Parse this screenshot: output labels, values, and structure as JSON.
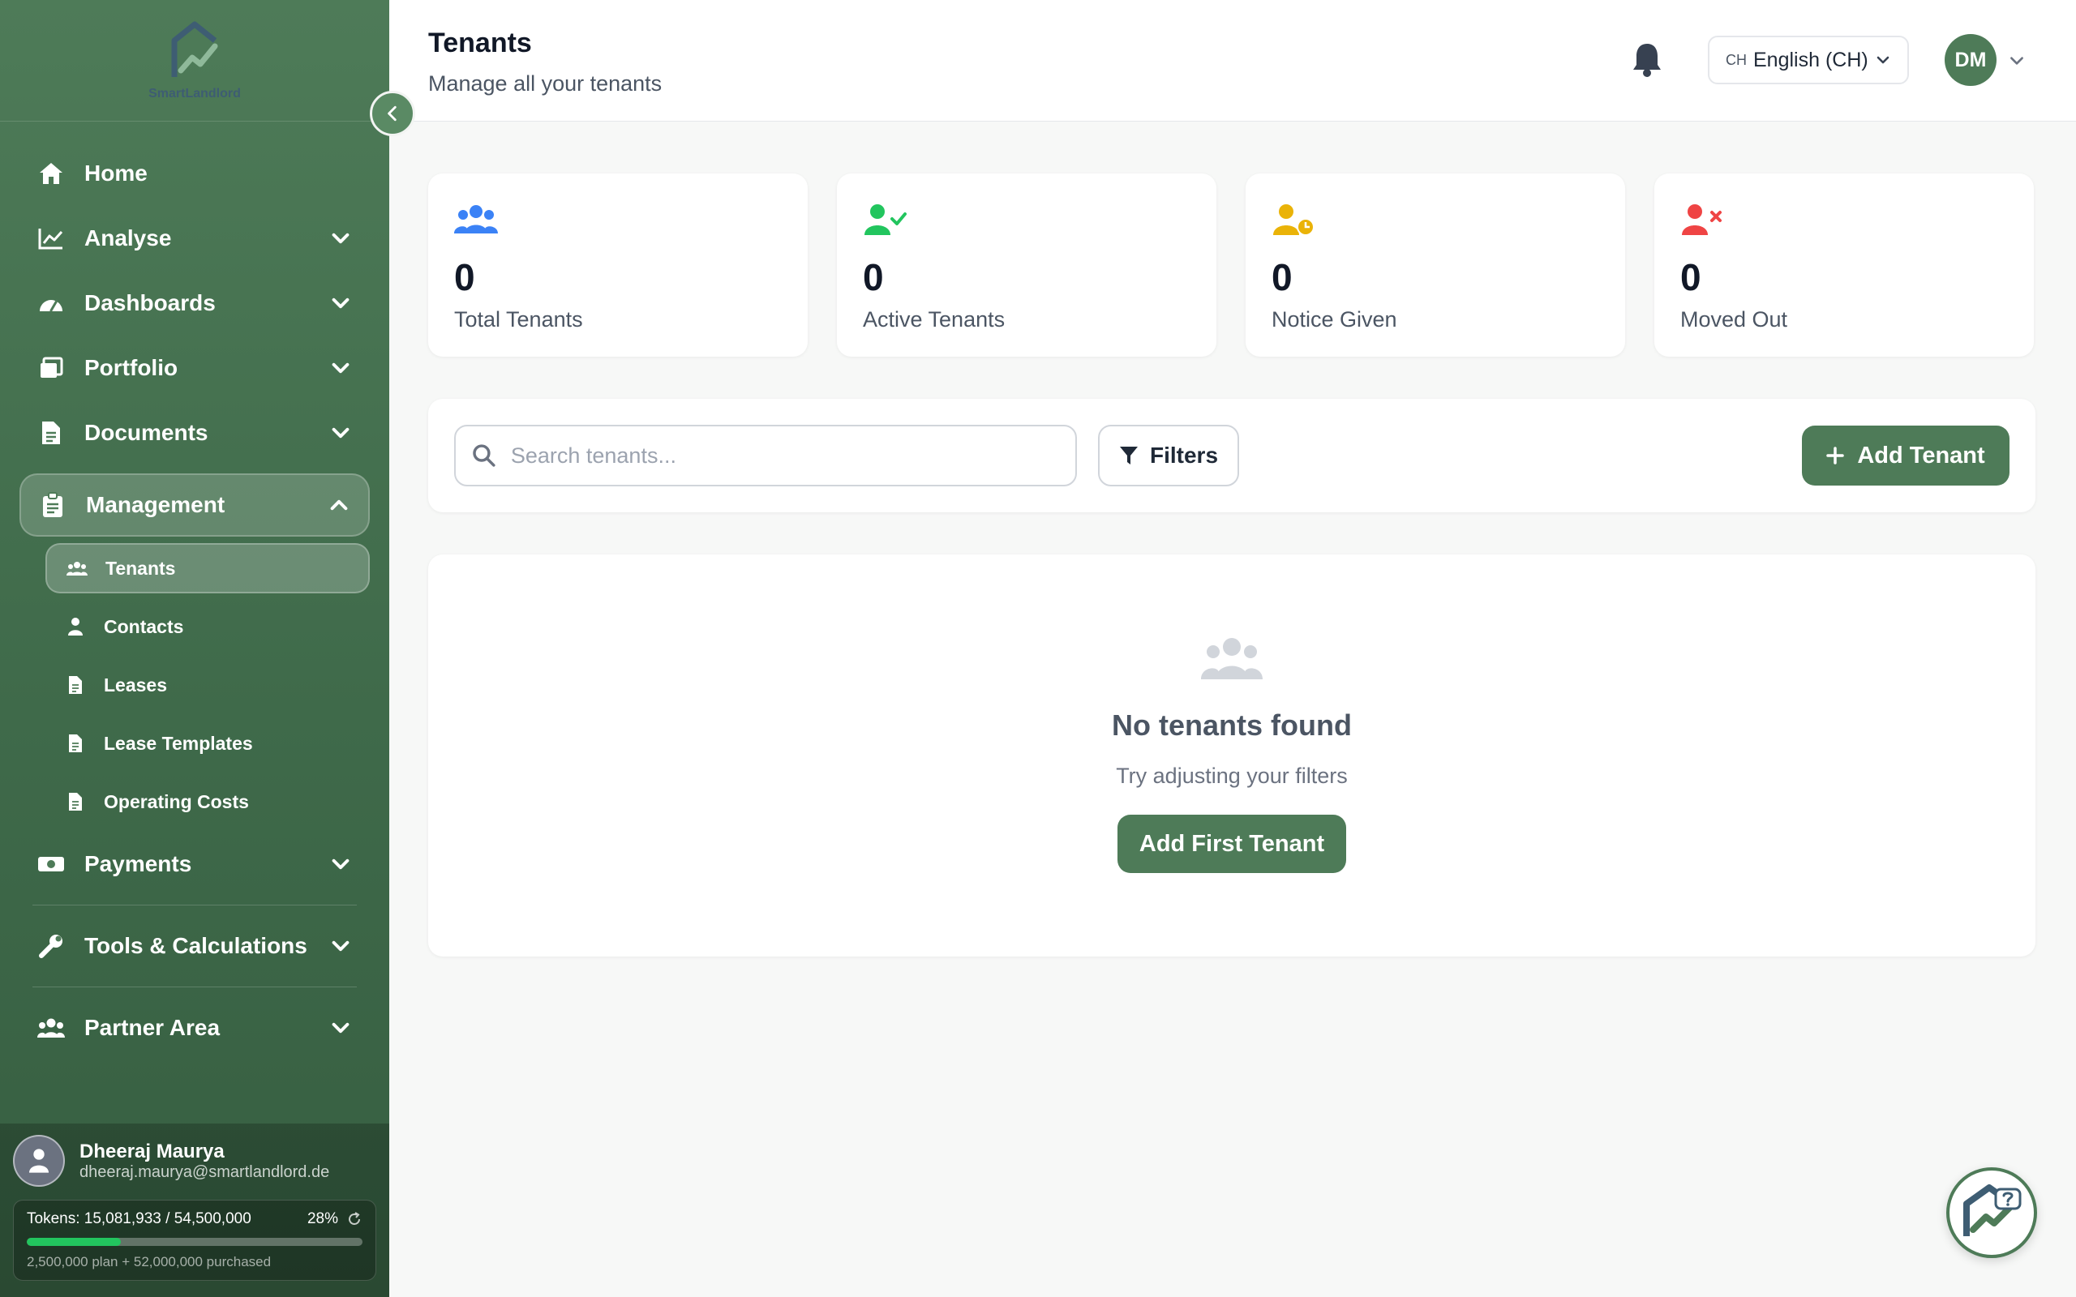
{
  "brand": {
    "name": "SmartLandlord"
  },
  "sidebar": {
    "items": [
      {
        "label": "Home",
        "icon": "home-icon"
      },
      {
        "label": "Analyse",
        "icon": "chart-line-icon"
      },
      {
        "label": "Dashboards",
        "icon": "gauge-icon"
      },
      {
        "label": "Portfolio",
        "icon": "portfolio-icon"
      },
      {
        "label": "Documents",
        "icon": "document-icon"
      },
      {
        "label": "Management",
        "icon": "clipboard-icon"
      },
      {
        "label": "Payments",
        "icon": "money-icon"
      },
      {
        "label": "Tools & Calculations",
        "icon": "wrench-icon"
      },
      {
        "label": "Partner Area",
        "icon": "users-icon"
      }
    ],
    "management_sub": [
      {
        "label": "Tenants",
        "icon": "users-icon"
      },
      {
        "label": "Contacts",
        "icon": "user-icon"
      },
      {
        "label": "Leases",
        "icon": "file-icon"
      },
      {
        "label": "Lease Templates",
        "icon": "file-icon"
      },
      {
        "label": "Operating Costs",
        "icon": "file-icon"
      }
    ]
  },
  "user": {
    "name": "Dheeraj Maurya",
    "email": "dheeraj.maurya@smartlandlord.de",
    "tokens_text": "Tokens: 15,081,933 / 54,500,000",
    "tokens_pct": "28%",
    "tokens_fraction": 0.28,
    "tokens_sub": "2,500,000 plan + 52,000,000 purchased"
  },
  "header": {
    "title": "Tenants",
    "subtitle": "Manage all your tenants",
    "lang_code": "CH",
    "lang_label": "English (CH)",
    "avatar_initials": "DM"
  },
  "stats": [
    {
      "value": "0",
      "label": "Total Tenants",
      "color": "#3b82f6"
    },
    {
      "value": "0",
      "label": "Active Tenants",
      "color": "#22c55e"
    },
    {
      "value": "0",
      "label": "Notice Given",
      "color": "#eab308"
    },
    {
      "value": "0",
      "label": "Moved Out",
      "color": "#ef4444"
    }
  ],
  "toolbar": {
    "search_placeholder": "Search tenants...",
    "filters_label": "Filters",
    "add_label": "Add Tenant"
  },
  "empty_state": {
    "title": "No tenants found",
    "subtitle": "Try adjusting your filters",
    "button_label": "Add First Tenant"
  },
  "colors": {
    "primary": "#4e7b58",
    "sidebar_dark": "#365e41"
  }
}
